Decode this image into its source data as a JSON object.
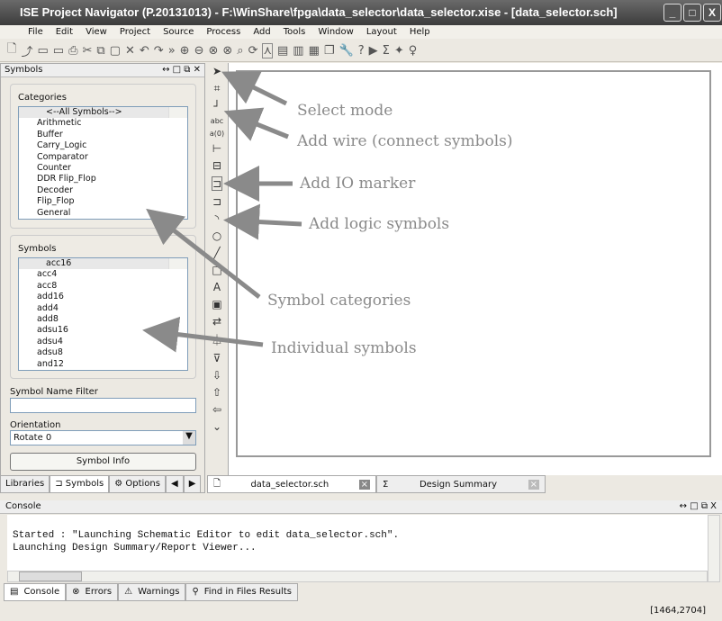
{
  "window": {
    "title": "ISE Project Navigator (P.20131013) - F:\\WinShare\\fpga\\data_selector\\data_selector.xise - [data_selector.sch]"
  },
  "menu": [
    "File",
    "Edit",
    "View",
    "Project",
    "Source",
    "Process",
    "Add",
    "Tools",
    "Window",
    "Layout",
    "Help"
  ],
  "symbols_panel": {
    "title": "Symbols",
    "categories_label": "Categories",
    "categories": [
      "<--All Symbols-->",
      "Arithmetic",
      "Buffer",
      "Carry_Logic",
      "Comparator",
      "Counter",
      "DDR Flip_Flop",
      "Decoder",
      "Flip_Flop",
      "General"
    ],
    "symbols_label": "Symbols",
    "symbols": [
      "acc16",
      "acc4",
      "acc8",
      "add16",
      "add4",
      "add8",
      "adsu16",
      "adsu4",
      "adsu8",
      "and12"
    ],
    "filter_label": "Symbol Name Filter",
    "filter_value": "",
    "orientation_label": "Orientation",
    "orientation_value": "Rotate 0",
    "symbol_info": "Symbol Info"
  },
  "left_tabs": [
    "Libraries",
    "Symbols",
    "Options"
  ],
  "editor_tabs": [
    "data_selector.sch",
    "Design Summary"
  ],
  "console": {
    "title": "Console",
    "lines": [
      "Started : \"Launching Schematic Editor to edit data_selector.sch\".",
      "Launching Design Summary/Report Viewer..."
    ]
  },
  "bottom_tabs": [
    "Console",
    "Errors",
    "Warnings",
    "Find in Files Results"
  ],
  "status": "[1464,2704]",
  "annotations": [
    "Select mode",
    "Add wire (connect symbols)",
    "Add IO marker",
    "Add logic symbols",
    "Symbol categories",
    "Individual symbols"
  ],
  "colors": {
    "annotation": "#8a8a8a",
    "titlebar": "#4a4a4a"
  }
}
